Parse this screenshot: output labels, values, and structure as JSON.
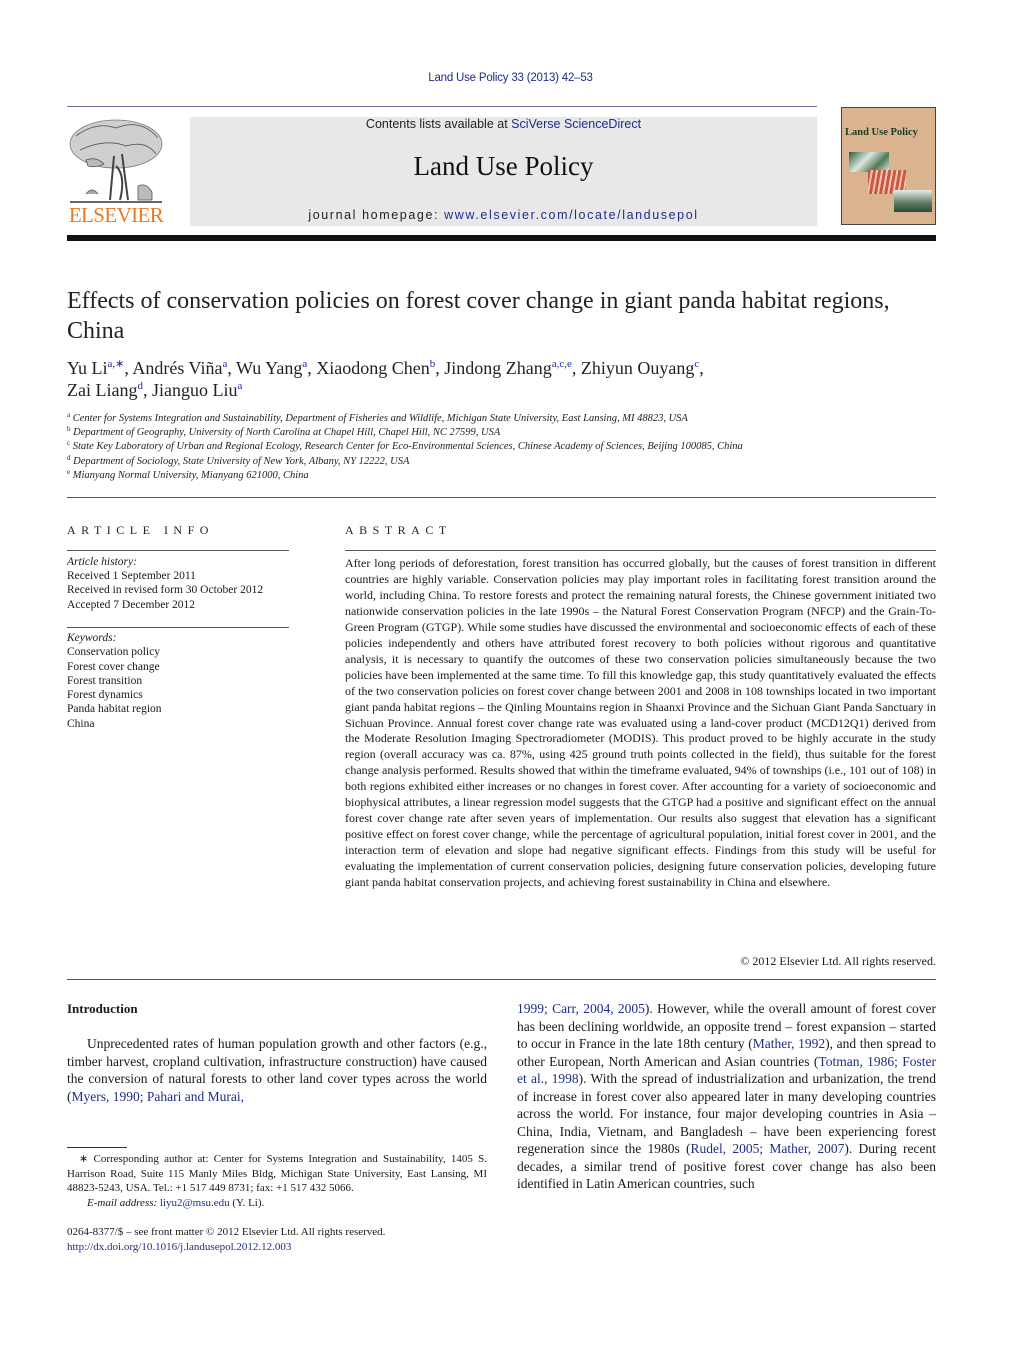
{
  "header": {
    "journal_ref": "Land Use Policy 33 (2013) 42–53",
    "contents_prefix": "Contents lists available at ",
    "contents_link": "SciVerse ScienceDirect",
    "journal_title": "Land Use Policy",
    "homepage_prefix": "journal homepage: ",
    "homepage_link": "www.elsevier.com/locate/landusepol",
    "publisher_logo_text": "ELSEVIER",
    "cover_title": "Land Use Policy",
    "colors": {
      "link": "#1f2c8a",
      "elsevier_orange": "#e87a22",
      "header_box": "#e8e8e8",
      "cover": "#d9b48f"
    }
  },
  "article": {
    "title": "Effects of conservation policies on forest cover change in giant panda habitat regions, China",
    "authors": [
      {
        "name": "Yu Li",
        "sup": "a,∗",
        "sep": ", "
      },
      {
        "name": "Andrés Viña",
        "sup": "a",
        "sep": ", "
      },
      {
        "name": "Wu Yang",
        "sup": "a",
        "sep": ", "
      },
      {
        "name": "Xiaodong Chen",
        "sup": "b",
        "sep": ", "
      },
      {
        "name": "Jindong Zhang",
        "sup": "a,c,e",
        "sep": ", "
      },
      {
        "name": "Zhiyun Ouyang",
        "sup": "c",
        "sep": ","
      },
      {
        "name": "Zai Liang",
        "sup": "d",
        "sep": ", "
      },
      {
        "name": "Jianguo Liu",
        "sup": "a",
        "sep": ""
      }
    ],
    "affiliations": [
      {
        "key": "a",
        "text": "Center for Systems Integration and Sustainability, Department of Fisheries and Wildlife, Michigan State University, East Lansing, MI 48823, USA"
      },
      {
        "key": "b",
        "text": "Department of Geography, University of North Carolina at Chapel Hill, Chapel Hill, NC 27599, USA"
      },
      {
        "key": "c",
        "text": "State Key Laboratory of Urban and Regional Ecology, Research Center for Eco-Environmental Sciences, Chinese Academy of Sciences, Beijing 100085, China"
      },
      {
        "key": "d",
        "text": "Department of Sociology, State University of New York, Albany, NY 12222, USA"
      },
      {
        "key": "e",
        "text": "Mianyang Normal University, Mianyang 621000, China"
      }
    ]
  },
  "article_info": {
    "heading": "ARTICLE INFO",
    "history_label": "Article history:",
    "history": [
      "Received 1 September 2011",
      "Received in revised form 30 October 2012",
      "Accepted 7 December 2012"
    ],
    "keywords_label": "Keywords:",
    "keywords": [
      "Conservation policy",
      "Forest cover change",
      "Forest transition",
      "Forest dynamics",
      "Panda habitat region",
      "China"
    ]
  },
  "abstract": {
    "heading": "ABSTRACT",
    "text": "After long periods of deforestation, forest transition has occurred globally, but the causes of forest transition in different countries are highly variable. Conservation policies may play important roles in facilitating forest transition around the world, including China. To restore forests and protect the remaining natural forests, the Chinese government initiated two nationwide conservation policies in the late 1990s – the Natural Forest Conservation Program (NFCP) and the Grain-To-Green Program (GTGP). While some studies have discussed the environmental and socioeconomic effects of each of these policies independently and others have attributed forest recovery to both policies without rigorous and quantitative analysis, it is necessary to quantify the outcomes of these two conservation policies simultaneously because the two policies have been implemented at the same time. To fill this knowledge gap, this study quantitatively evaluated the effects of the two conservation policies on forest cover change between 2001 and 2008 in 108 townships located in two important giant panda habitat regions – the Qinling Mountains region in Shaanxi Province and the Sichuan Giant Panda Sanctuary in Sichuan Province. Annual forest cover change rate was evaluated using a land-cover product (MCD12Q1) derived from the Moderate Resolution Imaging Spectroradiometer (MODIS). This product proved to be highly accurate in the study region (overall accuracy was ca. 87%, using 425 ground truth points collected in the field), thus suitable for the forest change analysis performed. Results showed that within the timeframe evaluated, 94% of townships (i.e., 101 out of 108) in both regions exhibited either increases or no changes in forest cover. After accounting for a variety of socioeconomic and biophysical attributes, a linear regression model suggests that the GTGP had a positive and significant effect on the annual forest cover change rate after seven years of implementation. Our results also suggest that elevation has a significant positive effect on forest cover change, while the percentage of agricultural population, initial forest cover in 2001, and the interaction term of elevation and slope had negative significant effects. Findings from this study will be useful for evaluating the implementation of current conservation policies, designing future conservation policies, developing future giant panda habitat conservation projects, and achieving forest sustainability in China and elsewhere.",
    "copyright": "© 2012 Elsevier Ltd. All rights reserved."
  },
  "introduction": {
    "heading": "Introduction",
    "left_text": "Unprecedented rates of human population growth and other factors (e.g., timber harvest, cropland cultivation, infrastructure construction) have caused the conversion of natural forests to other land cover types across the world (",
    "left_cite": "Myers, 1990; Pahari and Murai,",
    "right_segments": [
      {
        "t": "1999; Carr, 2004, 2005",
        "cite": true
      },
      {
        "t": "). However, while the overall amount of forest cover has been declining worldwide, an opposite trend – forest expansion – started to occur in France in the late 18th century (",
        "cite": false
      },
      {
        "t": "Mather, 1992",
        "cite": true
      },
      {
        "t": "), and then spread to other European, North American and Asian countries (",
        "cite": false
      },
      {
        "t": "Totman, 1986; Foster et al., 1998",
        "cite": true
      },
      {
        "t": "). With the spread of industrialization and urbanization, the trend of increase in forest cover also appeared later in many developing countries across the world. For instance, four major developing countries in Asia – China, India, Vietnam, and Bangladesh – have been experiencing forest regeneration since the 1980s (",
        "cite": false
      },
      {
        "t": "Rudel, 2005; Mather, 2007",
        "cite": true
      },
      {
        "t": "). During recent decades, a similar trend of positive forest cover change has also been identified in Latin American countries, such",
        "cite": false
      }
    ]
  },
  "footnote": {
    "corresponding": "∗ Corresponding author at: Center for Systems Integration and Sustainability, 1405 S. Harrison Road, Suite 115 Manly Miles Bldg, Michigan State University, East Lansing, MI 48823-5243, USA. Tel.: +1 517 449 8731; fax: +1 517 432 5066.",
    "email_label": "E-mail address: ",
    "email": "liyu2@msu.edu",
    "email_suffix": " (Y. Li).",
    "issn_line": "0264-8377/$ – see front matter © 2012 Elsevier Ltd. All rights reserved.",
    "doi": "http://dx.doi.org/10.1016/j.landusepol.2012.12.003"
  }
}
